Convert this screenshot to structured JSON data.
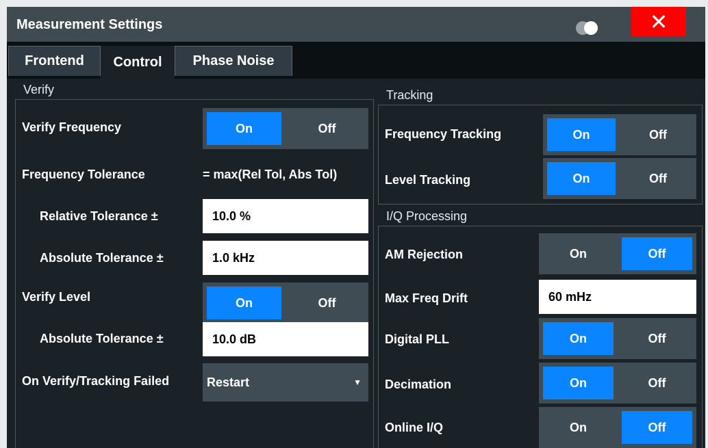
{
  "window": {
    "title": "Measurement Settings",
    "close_label": "✕"
  },
  "tabs": [
    {
      "label": "Frontend"
    },
    {
      "label": "Control"
    },
    {
      "label": "Phase Noise"
    }
  ],
  "verify": {
    "section_label": "Verify",
    "verify_frequency": {
      "label": "Verify Frequency",
      "on": "On",
      "off": "Off",
      "selected": "On"
    },
    "frequency_tolerance": {
      "label": "Frequency Tolerance",
      "formula": "= max(Rel Tol, Abs Tol)"
    },
    "relative_tolerance": {
      "label": "Relative Tolerance ±",
      "value": "10.0 %"
    },
    "absolute_tolerance": {
      "label": "Absolute Tolerance ±",
      "value": "1.0 kHz"
    },
    "verify_level": {
      "label": "Verify Level",
      "on": "On",
      "off": "Off",
      "selected": "On"
    },
    "level_absolute_tolerance": {
      "label": "Absolute Tolerance ±",
      "value": "10.0 dB"
    },
    "on_failed": {
      "label": "On Verify/Tracking Failed",
      "value": "Restart"
    }
  },
  "tracking": {
    "section_label": "Tracking",
    "frequency_tracking": {
      "label": "Frequency Tracking",
      "on": "On",
      "off": "Off",
      "selected": "On"
    },
    "level_tracking": {
      "label": "Level Tracking",
      "on": "On",
      "off": "Off",
      "selected": "On"
    }
  },
  "iq": {
    "section_label": "I/Q Processing",
    "am_rejection": {
      "label": "AM Rejection",
      "on": "On",
      "off": "Off",
      "selected": "Off"
    },
    "max_freq_drift": {
      "label": "Max Freq Drift",
      "value": "60 mHz"
    },
    "digital_pll": {
      "label": "Digital PLL",
      "on": "On",
      "off": "Off",
      "selected": "On"
    },
    "decimation": {
      "label": "Decimation",
      "on": "On",
      "off": "Off",
      "selected": "On"
    },
    "online_iq": {
      "label": "Online I/Q",
      "on": "On",
      "off": "Off",
      "selected": "Off"
    }
  },
  "colors": {
    "selected": "#0a84ff",
    "close": "#ff0000",
    "panel": "#1a2228",
    "control_bg": "#404c54"
  }
}
